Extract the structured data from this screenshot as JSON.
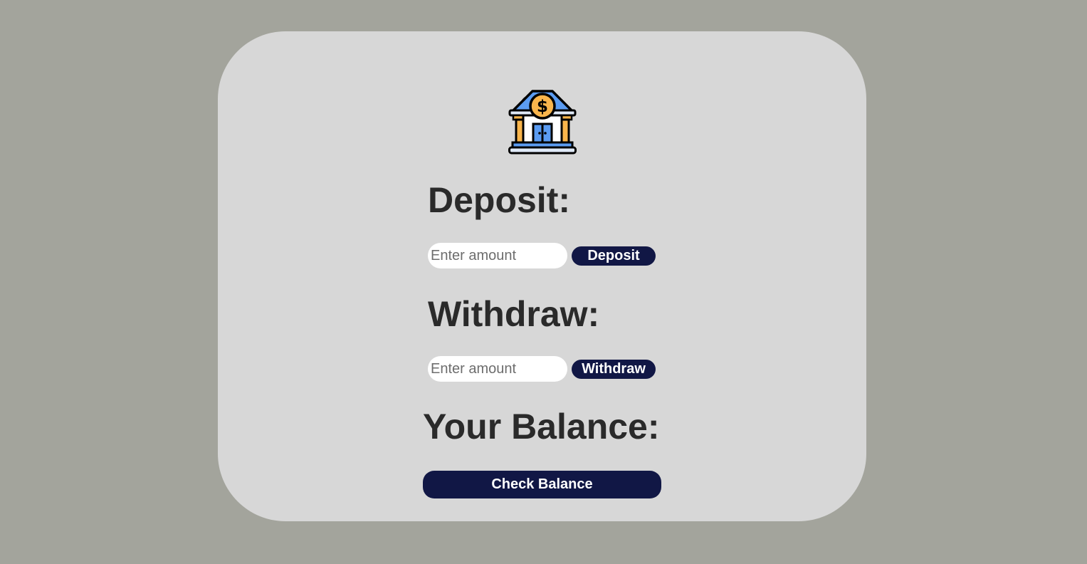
{
  "deposit": {
    "heading": "Deposit:",
    "input_placeholder": "Enter amount",
    "button_label": "Deposit"
  },
  "withdraw": {
    "heading": "Withdraw:",
    "input_placeholder": "Enter amount",
    "button_label": "Withdraw"
  },
  "balance": {
    "heading": "Your Balance:",
    "button_label": "Check Balance"
  },
  "icons": {
    "logo": "bank-icon"
  },
  "colors": {
    "page_background": "#a3a49c",
    "card_background": "#d7d7d7",
    "button_background": "#111745",
    "button_text": "#ffffff",
    "heading_text": "#2a2a2a",
    "icon_roof": "#5b9cf2",
    "icon_coin": "#f9b54c"
  }
}
